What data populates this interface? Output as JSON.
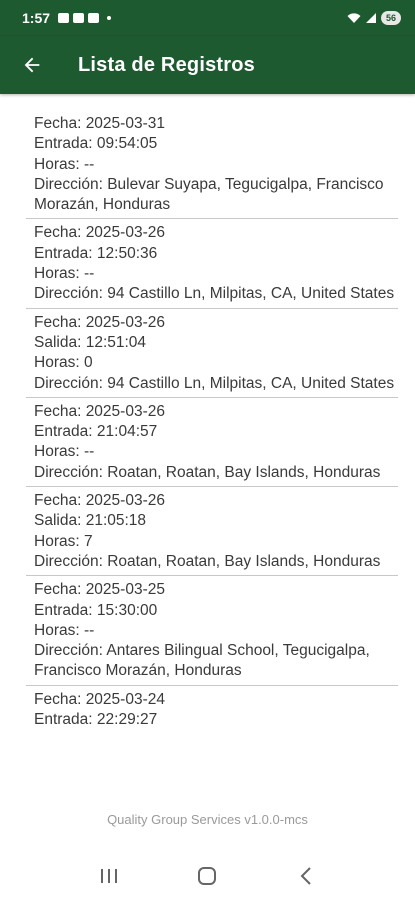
{
  "status_bar": {
    "time": "1:57",
    "battery": "56"
  },
  "app_bar": {
    "title": "Lista de Registros"
  },
  "records": [
    {
      "fecha": "Fecha: 2025-03-31",
      "evento": "Entrada: 09:54:05",
      "horas": "Horas: --",
      "direccion": "Dirección: Bulevar Suyapa, Tegucigalpa, Francisco Morazán, Honduras"
    },
    {
      "fecha": "Fecha: 2025-03-26",
      "evento": "Entrada: 12:50:36",
      "horas": "Horas: --",
      "direccion": "Dirección: 94 Castillo Ln, Milpitas, CA, United States"
    },
    {
      "fecha": "Fecha: 2025-03-26",
      "evento": "Salida: 12:51:04",
      "horas": "Horas: 0",
      "direccion": "Dirección: 94 Castillo Ln, Milpitas, CA, United States"
    },
    {
      "fecha": "Fecha: 2025-03-26",
      "evento": "Entrada: 21:04:57",
      "horas": "Horas: --",
      "direccion": "Dirección: Roatan, Roatan, Bay Islands, Honduras"
    },
    {
      "fecha": "Fecha: 2025-03-26",
      "evento": "Salida: 21:05:18",
      "horas": "Horas: 7",
      "direccion": "Dirección: Roatan, Roatan, Bay Islands, Honduras"
    },
    {
      "fecha": "Fecha: 2025-03-25",
      "evento": "Entrada: 15:30:00",
      "horas": "Horas: --",
      "direccion": "Dirección: Antares Bilingual School, Tegucigalpa, Francisco Morazán, Honduras"
    },
    {
      "fecha": "Fecha: 2025-03-24",
      "evento": "Entrada: 22:29:27"
    }
  ],
  "footer": {
    "text": "Quality Group Services v1.0.0-mcs"
  },
  "colors": {
    "primary": "#1e5a30",
    "divider": "#c8c8c8",
    "text": "#3a3a3a",
    "footer_text": "#9a9a9a"
  },
  "icons": {
    "back": "arrow-left-icon",
    "nav_recents": "recents-icon",
    "nav_home": "home-icon",
    "nav_back": "chevron-left-icon"
  }
}
